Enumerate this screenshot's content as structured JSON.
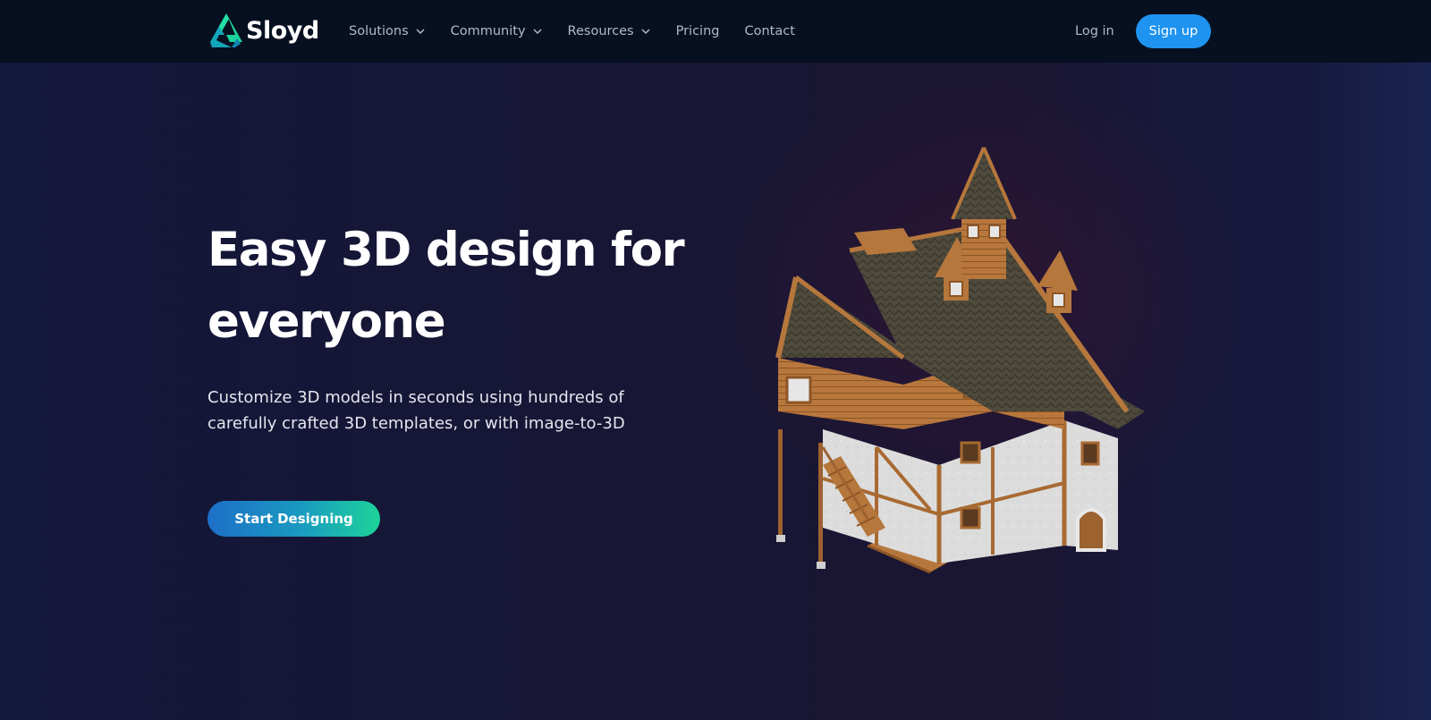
{
  "brand": {
    "name": "Sloyd"
  },
  "nav": {
    "items": [
      {
        "label": "Solutions",
        "has_dropdown": true
      },
      {
        "label": "Community",
        "has_dropdown": true
      },
      {
        "label": "Resources",
        "has_dropdown": true
      },
      {
        "label": "Pricing",
        "has_dropdown": false
      },
      {
        "label": "Contact",
        "has_dropdown": false
      }
    ],
    "login_label": "Log in",
    "signup_label": "Sign up"
  },
  "hero": {
    "title_line1": "Easy 3D design for",
    "title_line2": "everyone",
    "subtitle": "Customize 3D models in seconds using hundreds of carefully crafted 3D templates, or with image-to-3D",
    "cta_label": "Start Designing"
  },
  "colors": {
    "nav_bg": "#061020",
    "signup_bg": "#1e93f0",
    "cta_gradient_start": "#1d6fc8",
    "cta_gradient_end": "#1cd39a",
    "logo_accent": "#1cd39a"
  },
  "icons": {
    "logo": "sloyd-logo-icon",
    "dropdown": "chevron-down-icon"
  }
}
